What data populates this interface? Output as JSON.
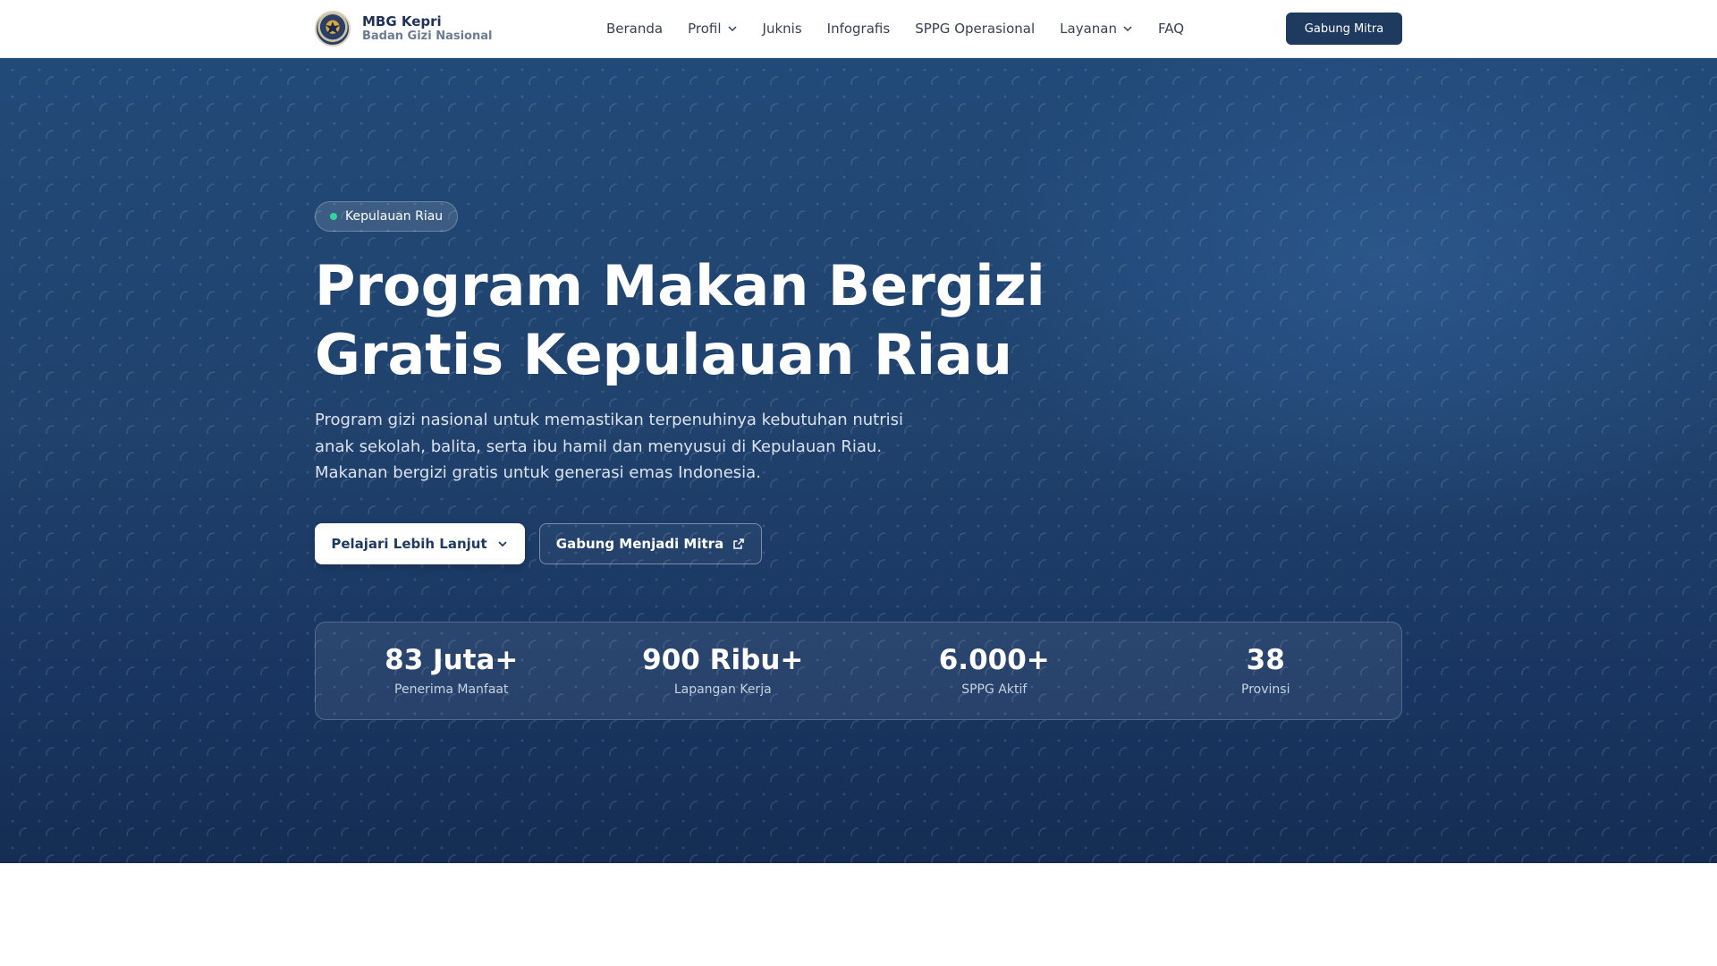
{
  "brand": {
    "title": "MBG Kepri",
    "subtitle": "Badan Gizi Nasional"
  },
  "nav": {
    "items": [
      {
        "label": "Beranda",
        "has_dropdown": false
      },
      {
        "label": "Profil",
        "has_dropdown": true
      },
      {
        "label": "Juknis",
        "has_dropdown": false
      },
      {
        "label": "Infografis",
        "has_dropdown": false
      },
      {
        "label": "SPPG Operasional",
        "has_dropdown": false
      },
      {
        "label": "Layanan",
        "has_dropdown": true
      },
      {
        "label": "FAQ",
        "has_dropdown": false
      }
    ],
    "cta_label": "Gabung Mitra"
  },
  "hero": {
    "badge_label": "Kepulauan Riau",
    "title_line1": "Program Makan Bergizi",
    "title_line2": "Gratis Kepulauan Riau",
    "description_line1": "Program gizi nasional untuk memastikan terpenuhinya kebutuhan nutrisi",
    "description_line2": "anak sekolah, balita, serta ibu hamil dan menyusui di Kepulauan Riau.",
    "description_line3": "Makanan bergizi gratis untuk generasi emas Indonesia.",
    "primary_button_label": "Pelajari Lebih Lanjut",
    "secondary_button_label": "Gabung Menjadi Mitra"
  },
  "stats": [
    {
      "value": "83 Juta+",
      "label": "Penerima Manfaat"
    },
    {
      "value": "900 Ribu+",
      "label": "Lapangan Kerja"
    },
    {
      "value": "6.000+",
      "label": "SPPG Aktif"
    },
    {
      "value": "38",
      "label": "Provinsi"
    }
  ],
  "icons": {
    "logo": "garuda-emblem-icon",
    "dropdown": "chevron-down-icon",
    "external": "external-link-icon",
    "badge_dot": "status-dot-icon"
  },
  "colors": {
    "brand_navy": "#1e3a5f",
    "hero_top": "#224a78",
    "hero_bottom": "#152d52",
    "badge_dot": "#34d399"
  }
}
